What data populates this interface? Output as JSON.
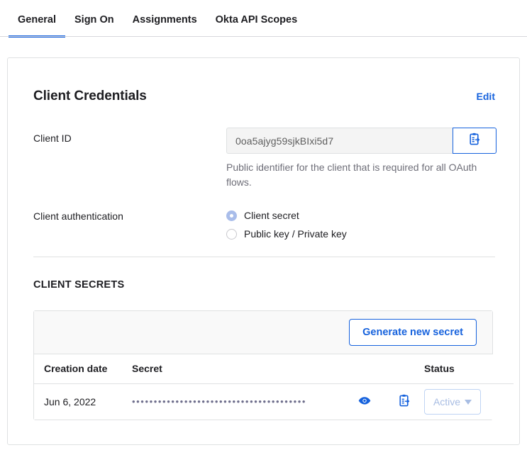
{
  "tabs": [
    {
      "label": "General",
      "active": true
    },
    {
      "label": "Sign On",
      "active": false
    },
    {
      "label": "Assignments",
      "active": false
    },
    {
      "label": "Okta API Scopes",
      "active": false
    }
  ],
  "colors": {
    "accent": "#1662dd",
    "muted_accent": "#a8bde3",
    "border": "#dfe1e2",
    "text": "#1d1d21",
    "help_text": "#6e6e78",
    "toolbar_bg": "#f9f9f9",
    "input_bg": "#f4f4f4"
  },
  "client_credentials": {
    "title": "Client Credentials",
    "edit_label": "Edit",
    "client_id": {
      "label": "Client ID",
      "value": "0oa5ajyg59sjkBIxi5d7",
      "help": "Public identifier for the client that is required for all OAuth flows.",
      "copy_icon": "clipboard-copy-icon"
    },
    "client_authentication": {
      "label": "Client authentication",
      "options": [
        {
          "label": "Client secret",
          "selected": true
        },
        {
          "label": "Public key / Private key",
          "selected": false
        }
      ]
    }
  },
  "client_secrets": {
    "title": "CLIENT SECRETS",
    "generate_button_label": "Generate new secret",
    "columns": [
      "Creation date",
      "Secret",
      "",
      "",
      "Status"
    ],
    "rows": [
      {
        "creation_date": "Jun 6, 2022",
        "secret_masked": "••••••••••••••••••••••••••••••••••••••••",
        "reveal_icon": "eye-icon",
        "copy_icon": "clipboard-copy-icon",
        "status": "Active",
        "status_caret": "chevron-down-icon"
      }
    ]
  }
}
